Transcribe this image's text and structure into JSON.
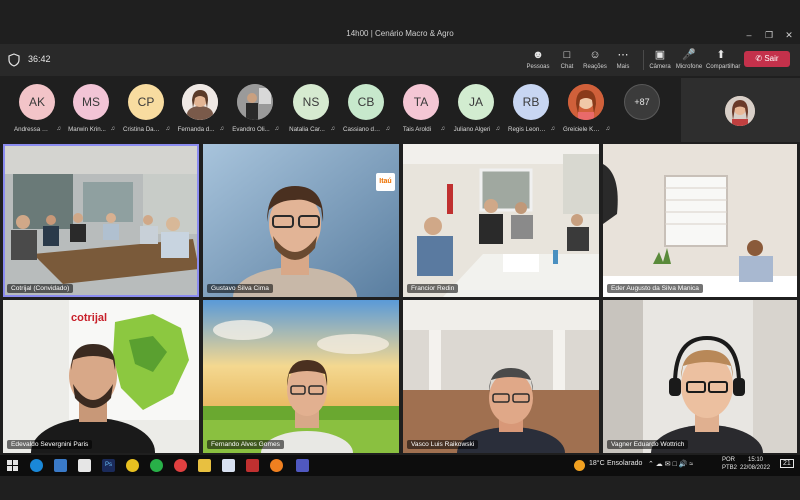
{
  "window": {
    "title": "14h00 | Cenário Macro & Agro",
    "controls": [
      "minimize-icon",
      "restore-icon",
      "close-icon"
    ]
  },
  "toolbar": {
    "timer": "36:42",
    "buttons": [
      {
        "label": "Pessoas",
        "icon": "people-icon"
      },
      {
        "label": "Chat",
        "icon": "chat-icon"
      },
      {
        "label": "Reações",
        "icon": "reactions-icon"
      },
      {
        "label": "Mais",
        "icon": "more-icon"
      },
      {
        "label": "Câmera",
        "icon": "camera-icon"
      },
      {
        "label": "Microfone",
        "icon": "microphone-icon"
      },
      {
        "label": "Compartilhar",
        "icon": "share-icon"
      }
    ],
    "leave_label": "Sair"
  },
  "participants": [
    {
      "initials": "AK",
      "name": "Andressa Kr...",
      "color": "#f2c4c8"
    },
    {
      "initials": "MS",
      "name": "Marwin Krin...",
      "color": "#f2c4d6"
    },
    {
      "initials": "CP",
      "name": "Cristina Dal ...",
      "color": "#f8dca0"
    },
    {
      "initials": "",
      "name": "Fernanda d...",
      "color": "#a07a62"
    },
    {
      "initials": "",
      "name": "Evandro Oli...",
      "color": "#6a6a6a"
    },
    {
      "initials": "NS",
      "name": "Natalia Car...",
      "color": "#d6ead0"
    },
    {
      "initials": "CB",
      "name": "Cassiano de...",
      "color": "#c7e8cc"
    },
    {
      "initials": "TA",
      "name": "Tais Aroldi",
      "color": "#f4c6d4"
    },
    {
      "initials": "JA",
      "name": "Juliano Algeri",
      "color": "#d2ecd0"
    },
    {
      "initials": "RB",
      "name": "Regis Leona...",
      "color": "#c8d6f2"
    },
    {
      "initials": "",
      "name": "Greiciele Ko...",
      "color": "#b0603c"
    }
  ],
  "overflow_count": "+87",
  "tiles": [
    {
      "name": "Cotrijal (Convidado)"
    },
    {
      "name": "Gustavo Silva Cima",
      "logo": "Itaú"
    },
    {
      "name": "Francior Redin"
    },
    {
      "name": "Eder Augusto da Silva Manica"
    },
    {
      "name": "Edevaldo Severgnini Paris",
      "brand": "cotrijal"
    },
    {
      "name": "Fernando Alves Gomes"
    },
    {
      "name": "Vasco Luis Raikowski"
    },
    {
      "name": "Vagner Eduardo Wottrich"
    }
  ],
  "taskbar": {
    "weather_temp": "18°C",
    "weather_label": "Ensolarado",
    "lang_top": "POR",
    "lang_bottom": "PTB2",
    "time": "15:10",
    "date": "22/08/2022",
    "notifications": "21"
  },
  "colors": {
    "accent": "#8b8cf0",
    "leave": "#c4314b",
    "background": "#1f1f1f"
  }
}
